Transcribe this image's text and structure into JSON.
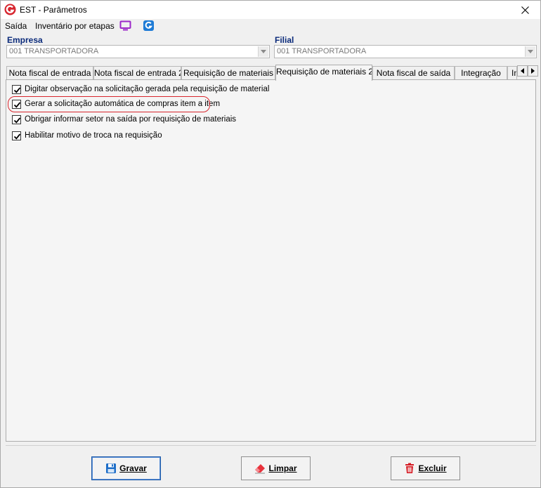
{
  "window": {
    "title": "EST - Parâmetros"
  },
  "menu": {
    "items": [
      "Saída",
      "Inventário por etapas"
    ],
    "icons": [
      "monitor-icon",
      "app-g-icon"
    ]
  },
  "empresa": {
    "label": "Empresa",
    "value": "001 TRANSPORTADORA"
  },
  "filial": {
    "label": "Filial",
    "value": "001 TRANSPORTADORA"
  },
  "tabs": [
    {
      "label": "Nota fiscal de entrada",
      "active": false
    },
    {
      "label": "Nota fiscal de entrada 2",
      "active": false
    },
    {
      "label": "Requisição de materiais",
      "active": false
    },
    {
      "label": "Requisição de materiais 2",
      "active": true
    },
    {
      "label": "Nota fiscal de saída",
      "active": false
    },
    {
      "label": "Integração",
      "active": false
    },
    {
      "label": "In",
      "active": false
    }
  ],
  "options": [
    {
      "label": "Digitar observação na solicitação gerada pela requisição de material",
      "checked": true
    },
    {
      "label": "Gerar a solicitação automática de compras item a item",
      "checked": true,
      "highlighted": true
    },
    {
      "label": "Obrigar informar setor na saída por requisição de materiais",
      "checked": true
    },
    {
      "label": "Habilitar motivo de troca na requisição",
      "checked": true
    }
  ],
  "buttons": {
    "gravar": "Gravar",
    "limpar": "Limpar",
    "excluir": "Excluir"
  },
  "colors": {
    "label_blue": "#0a2a7a",
    "highlight_red": "#d8262d",
    "brand_red": "#d7262f",
    "menu_purple": "#9b27c9",
    "menu_blue": "#1e7bd6"
  }
}
